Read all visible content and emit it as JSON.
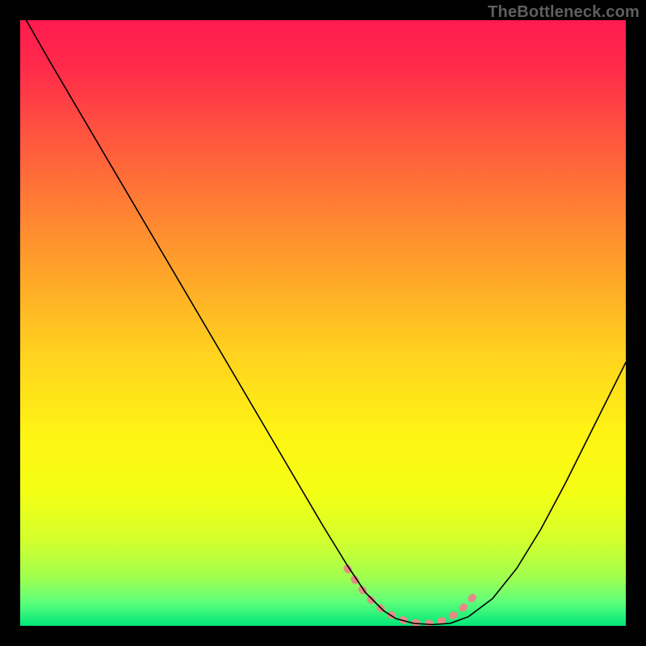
{
  "watermark": "TheBottleneck.com",
  "chart_data": {
    "type": "line",
    "title": "",
    "xlabel": "",
    "ylabel": "",
    "xlim": [
      0,
      100
    ],
    "ylim": [
      0,
      100
    ],
    "background_gradient": {
      "stops": [
        {
          "offset": 0.0,
          "color": "#ff1a4f"
        },
        {
          "offset": 0.08,
          "color": "#ff2b4a"
        },
        {
          "offset": 0.18,
          "color": "#ff5140"
        },
        {
          "offset": 0.3,
          "color": "#ff7c34"
        },
        {
          "offset": 0.42,
          "color": "#ffa529"
        },
        {
          "offset": 0.55,
          "color": "#ffd21e"
        },
        {
          "offset": 0.68,
          "color": "#fff314"
        },
        {
          "offset": 0.78,
          "color": "#f4ff14"
        },
        {
          "offset": 0.86,
          "color": "#d2ff2d"
        },
        {
          "offset": 0.92,
          "color": "#a0ff4f"
        },
        {
          "offset": 0.96,
          "color": "#5fff7a"
        },
        {
          "offset": 1.0,
          "color": "#00e87a"
        }
      ]
    },
    "series": [
      {
        "name": "bottleneck-curve",
        "color": "#000000",
        "width": 1.6,
        "x": [
          1,
          5,
          10,
          15,
          20,
          25,
          30,
          35,
          40,
          45,
          50,
          54,
          57,
          60,
          62,
          65,
          68,
          71,
          74,
          78,
          82,
          86,
          90,
          94,
          97,
          100
        ],
        "y": [
          100,
          93,
          84.5,
          76,
          67.5,
          59,
          50.5,
          42,
          33.5,
          25,
          16.5,
          10,
          5.5,
          2.5,
          1.2,
          0.4,
          0.2,
          0.4,
          1.5,
          4.5,
          9.5,
          16,
          23.5,
          31.5,
          37.5,
          43.5
        ]
      }
    ],
    "highlight": {
      "name": "optimal-zone",
      "color": "#e58b86",
      "width": 9,
      "x": [
        54,
        56,
        58,
        60,
        62,
        64,
        66,
        68,
        70,
        72,
        73.5,
        75
      ],
      "y": [
        9.5,
        6.5,
        4.2,
        2.5,
        1.4,
        0.7,
        0.4,
        0.4,
        0.9,
        2.0,
        3.3,
        5.0
      ]
    }
  }
}
